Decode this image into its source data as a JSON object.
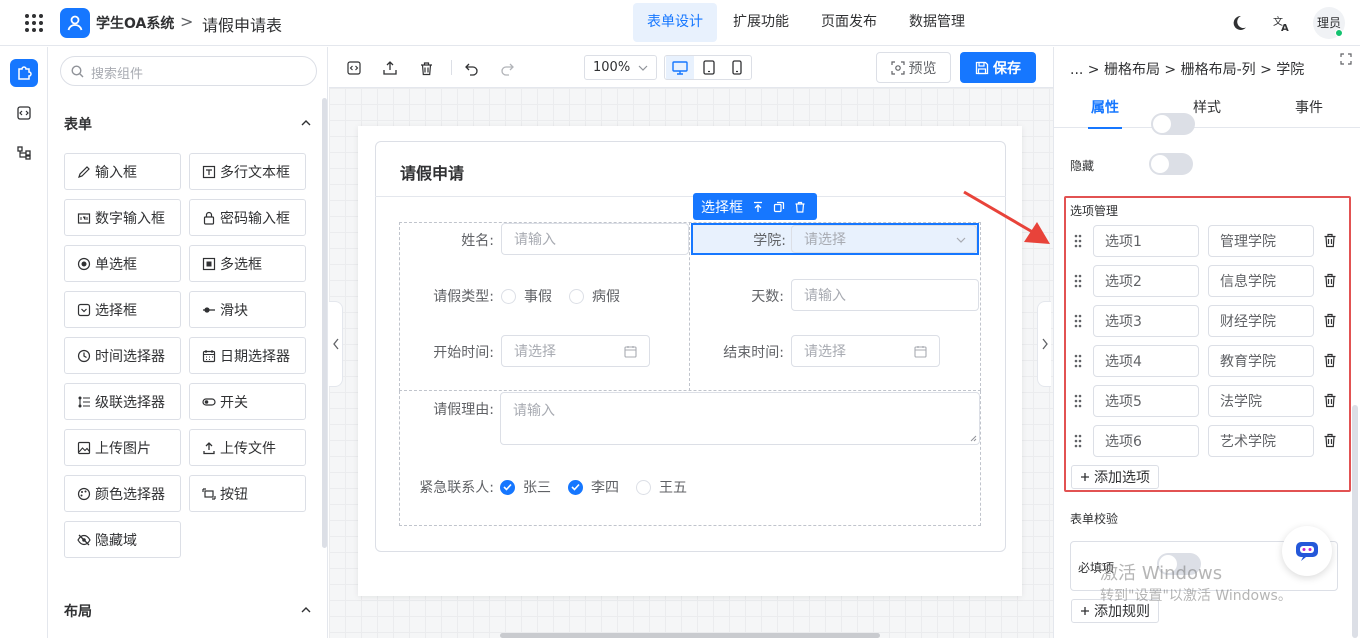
{
  "header": {
    "app_name": "学生OA系统",
    "separator": ">",
    "page_title": "请假申请表",
    "nav": [
      "表单设计",
      "扩展功能",
      "页面发布",
      "数据管理"
    ],
    "active_nav": 0,
    "avatar_text": "理员"
  },
  "components": {
    "search_placeholder": "搜索组件",
    "form_section": "表单",
    "items": [
      "输入框",
      "多行文本框",
      "数字输入框",
      "密码输入框",
      "单选框",
      "多选框",
      "选择框",
      "滑块",
      "时间选择器",
      "日期选择器",
      "级联选择器",
      "开关",
      "上传图片",
      "上传文件",
      "颜色选择器",
      "按钮",
      "隐藏域"
    ],
    "layout_section": "布局"
  },
  "toolbar": {
    "zoom": "100%",
    "preview": "预览",
    "save": "保存"
  },
  "form": {
    "title": "请假申请",
    "selected_tag": "选择框",
    "name_label": "姓名:",
    "name_placeholder": "请输入",
    "college_label": "学院:",
    "college_placeholder": "请选择",
    "leave_type_label": "请假类型:",
    "leave_type_options": [
      "事假",
      "病假"
    ],
    "days_label": "天数:",
    "days_placeholder": "请输入",
    "start_label": "开始时间:",
    "start_placeholder": "请选择",
    "end_label": "结束时间:",
    "end_placeholder": "请选择",
    "reason_label": "请假理由:",
    "reason_placeholder": "请输入",
    "contact_label": "紧急联系人:",
    "contacts": [
      {
        "label": "张三",
        "checked": true
      },
      {
        "label": "李四",
        "checked": true
      },
      {
        "label": "王五",
        "checked": false
      }
    ]
  },
  "props": {
    "breadcrumb": "... > 栅格布局 > 栅格布局-列 > 学院",
    "tabs": [
      "属性",
      "样式",
      "事件"
    ],
    "active_tab": 0,
    "hidden_label": "隐藏",
    "options_title": "选项管理",
    "options": [
      {
        "label": "选项1",
        "value": "管理学院"
      },
      {
        "label": "选项2",
        "value": "信息学院"
      },
      {
        "label": "选项3",
        "value": "财经学院"
      },
      {
        "label": "选项4",
        "value": "教育学院"
      },
      {
        "label": "选项5",
        "value": "法学院"
      },
      {
        "label": "选项6",
        "value": "艺术学院"
      }
    ],
    "add_option": "添加选项",
    "validation_title": "表单校验",
    "required_label": "必填项",
    "add_rule": "添加规则"
  },
  "watermark": {
    "line1": "激活 Windows",
    "line2": "转到\"设置\"以激活 Windows。"
  },
  "colors": {
    "accent": "#1677ff",
    "highlight_border": "#e25252"
  }
}
